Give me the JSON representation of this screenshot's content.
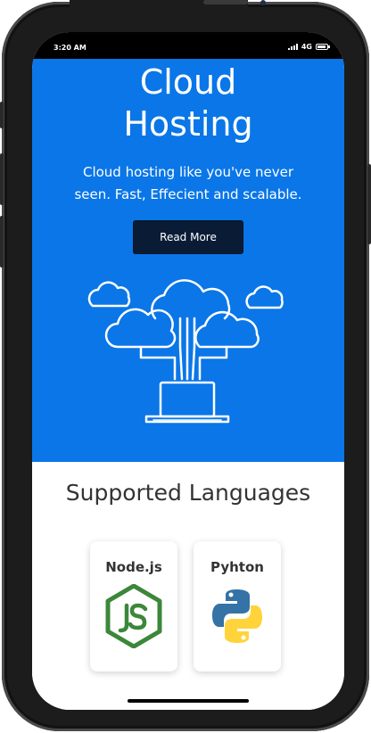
{
  "status_bar": {
    "time": "3:20 AM",
    "network": "4G"
  },
  "hero": {
    "title_line1": "Cloud",
    "title_line2": "Hosting",
    "subtitle_line1": "Cloud hosting like you've never",
    "subtitle_line2": "seen. Fast, Effecient and scalable.",
    "button_label": "Read More",
    "illustration": "cloud-network-laptop-icon",
    "background_color": "#0a76e8",
    "button_color": "#0a1c35"
  },
  "languages": {
    "title": "Supported Languages",
    "items": [
      {
        "name": "Node.js",
        "icon": "nodejs-icon",
        "color": "#3c873a"
      },
      {
        "name": "Pyhton",
        "icon": "python-icon",
        "colors": [
          "#3572a5",
          "#ffd43b"
        ]
      }
    ]
  }
}
